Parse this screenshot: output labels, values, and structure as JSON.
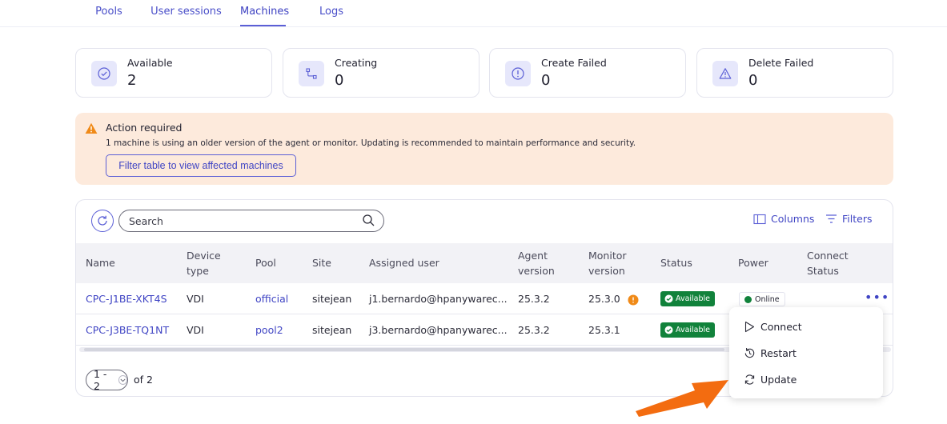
{
  "tabs": [
    {
      "label": "Pools"
    },
    {
      "label": "User sessions"
    },
    {
      "label": "Machines"
    },
    {
      "label": "Logs"
    }
  ],
  "active_tab": "Machines",
  "stats": [
    {
      "label": "Available",
      "value": "2",
      "icon": "check-circle-icon"
    },
    {
      "label": "Creating",
      "value": "0",
      "icon": "workflow-icon"
    },
    {
      "label": "Create Failed",
      "value": "0",
      "icon": "alert-circle-icon"
    },
    {
      "label": "Delete Failed",
      "value": "0",
      "icon": "warning-triangle-icon"
    }
  ],
  "alert": {
    "title": "Action required",
    "message": "1 machine is using an older version of the agent or monitor. Updating is recommended to maintain performance and security.",
    "button": "Filter table to view affected machines"
  },
  "toolbar": {
    "search_placeholder": "Search",
    "columns_label": "Columns",
    "filters_label": "Filters"
  },
  "table": {
    "headers": {
      "name": "Name",
      "device_type": [
        "Device",
        "type"
      ],
      "pool": "Pool",
      "site": "Site",
      "assigned_user": "Assigned user",
      "agent_version": [
        "Agent",
        "version"
      ],
      "monitor_version": [
        "Monitor",
        "version"
      ],
      "status": "Status",
      "power": "Power",
      "connect_status": [
        "Connect",
        "Status"
      ]
    },
    "rows": [
      {
        "name": "CPC-J1BE-XKT4S",
        "device_type": "VDI",
        "pool": "official",
        "site": "sitejean",
        "assigned_user": "j1.bernardo@hpanywarec...",
        "agent_version": "25.3.2",
        "monitor_version": "25.3.0",
        "status": "Available",
        "power": "Online"
      },
      {
        "name": "CPC-J3BE-TQ1NT",
        "device_type": "VDI",
        "pool": "pool2",
        "site": "sitejean",
        "assigned_user": "j3.bernardo@hpanywarec...",
        "agent_version": "25.3.2",
        "monitor_version": "25.3.1",
        "status": "Available",
        "power": ""
      }
    ]
  },
  "pagination": {
    "range": "1 - 2",
    "total": "of 2"
  },
  "menu": {
    "items": [
      {
        "label": "Connect",
        "icon": "play-icon"
      },
      {
        "label": "Restart",
        "icon": "restart-icon"
      },
      {
        "label": "Update",
        "icon": "sync-icon"
      }
    ]
  },
  "colors": {
    "accent": "#5b5fd6",
    "success": "#11823b",
    "warning": "#f08a18",
    "alert_bg": "#fdeadc"
  }
}
